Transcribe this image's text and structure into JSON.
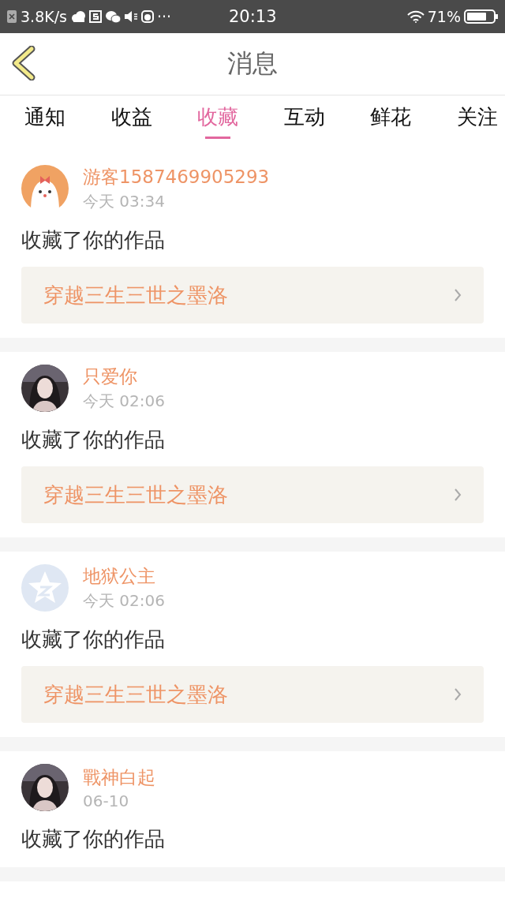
{
  "status_bar": {
    "speed": "3.8K/s",
    "more": "···",
    "time": "20:13",
    "battery_percent": "71%"
  },
  "header": {
    "title": "消息"
  },
  "tabs": [
    {
      "label": "通知",
      "selected": false
    },
    {
      "label": "收益",
      "selected": false
    },
    {
      "label": "收藏",
      "selected": true
    },
    {
      "label": "互动",
      "selected": false
    },
    {
      "label": "鲜花",
      "selected": false
    },
    {
      "label": "关注",
      "selected": false
    }
  ],
  "messages": [
    {
      "user": "游客1587469905293",
      "time": "今天 03:34",
      "text": "收藏了你的作品",
      "book": "穿越三生三世之墨洛",
      "avatar": {
        "kind": "cartoon"
      }
    },
    {
      "user": "只爱你",
      "time": "今天 02:06",
      "text": "收藏了你的作品",
      "book": "穿越三生三世之墨洛"
    },
    {
      "user": "地狱公主",
      "time": "今天 02:06",
      "text": "收藏了你的作品",
      "book": "穿越三生三世之墨洛",
      "avatar": {
        "kind": "default"
      }
    },
    {
      "user": "戰神白起",
      "time": "06-10",
      "text": "收藏了你的作品"
    }
  ]
}
